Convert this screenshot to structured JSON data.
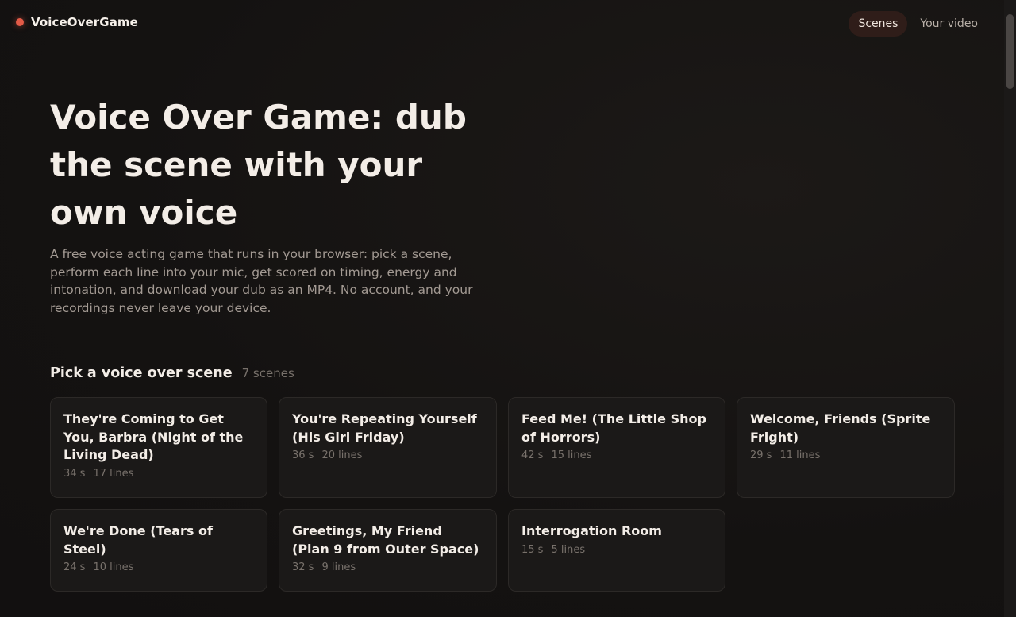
{
  "app": {
    "name": "VoiceOverGame"
  },
  "nav": {
    "tabs": [
      {
        "label": "Scenes"
      },
      {
        "label": "Your video"
      }
    ]
  },
  "hero": {
    "title": "Voice Over Game: dub the scene with your own voice",
    "description": "A free voice acting game that runs in your browser: pick a scene, perform each line into your mic, get scored on timing, energy and intonation, and download your dub as an MP4. No account, and your recordings never leave your device."
  },
  "scenes": {
    "heading": "Pick a voice over scene",
    "count": "7 scenes",
    "items": [
      {
        "title": "They're Coming to Get You, Barbra (Night of the Living Dead)",
        "duration": "34 s",
        "lines": "17 lines"
      },
      {
        "title": "You're Repeating Yourself (His Girl Friday)",
        "duration": "36 s",
        "lines": "20 lines"
      },
      {
        "title": "Feed Me! (The Little Shop of Horrors)",
        "duration": "42 s",
        "lines": "15 lines"
      },
      {
        "title": "Welcome, Friends (Sprite Fright)",
        "duration": "29 s",
        "lines": "11 lines"
      },
      {
        "title": "We're Done (Tears of Steel)",
        "duration": "24 s",
        "lines": "10 lines"
      },
      {
        "title": "Greetings, My Friend (Plan 9 from Outer Space)",
        "duration": "32 s",
        "lines": "9 lines"
      },
      {
        "title": "Interrogation Room",
        "duration": "15 s",
        "lines": "5 lines"
      }
    ]
  },
  "colors": {
    "accent": "#e25a47",
    "background": "#141211",
    "card": "#1b1918"
  }
}
